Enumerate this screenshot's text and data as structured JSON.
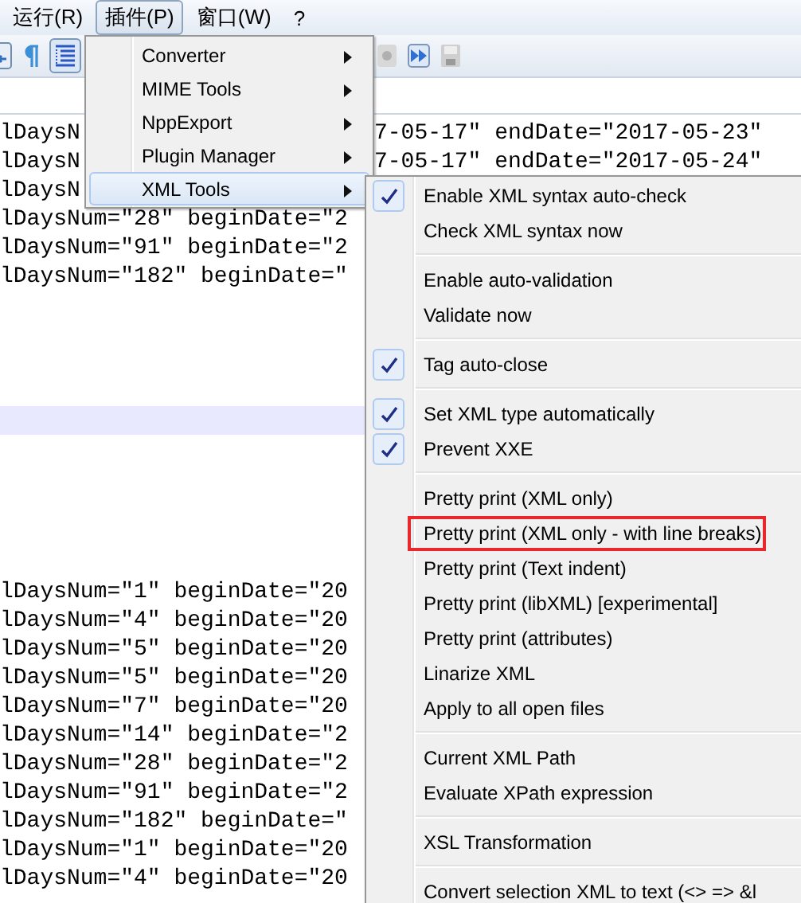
{
  "menubar": [
    {
      "label": "运行(R)",
      "selected": false
    },
    {
      "label": "插件(P)",
      "selected": true
    },
    {
      "label": "窗口(W)",
      "selected": false
    },
    {
      "label": "?",
      "selected": false
    }
  ],
  "toolbar": {
    "buttons": [
      {
        "selected": false
      },
      {
        "selected": false
      },
      {
        "selected": true
      },
      {
        "selected": false
      },
      {
        "selected": false
      },
      {
        "selected": false
      }
    ]
  },
  "editor": {
    "lines": [
      {
        "parts": [
          "lDaysN",
          "7-05-17\" endDate=\"2017-05-23\""
        ],
        "current": false
      },
      {
        "parts": [
          "lDaysN",
          "7-05-17\" endDate=\"2017-05-24\""
        ],
        "current": false
      },
      {
        "parts": [
          "lDaysN"
        ],
        "current": false
      },
      {
        "parts": [
          "lDaysNum=\"28\" beginDate=\"2"
        ],
        "current": false
      },
      {
        "parts": [
          "lDaysNum=\"91\" beginDate=\"2"
        ],
        "current": false
      },
      {
        "parts": [
          "lDaysNum=\"182\" beginDate=\""
        ],
        "current": false
      },
      {
        "current": false
      },
      {
        "current": false
      },
      {
        "current": false
      },
      {
        "current": false
      },
      {
        "current": true
      },
      {
        "current": false
      },
      {
        "current": false
      },
      {
        "current": false
      },
      {
        "current": false
      },
      {
        "current": false
      },
      {
        "parts": [
          "lDaysNum=\"1\" beginDate=\"20"
        ],
        "current": false
      },
      {
        "parts": [
          "lDaysNum=\"4\" beginDate=\"20"
        ],
        "current": false
      },
      {
        "parts": [
          "lDaysNum=\"5\" beginDate=\"20"
        ],
        "current": false
      },
      {
        "parts": [
          "lDaysNum=\"5\" beginDate=\"20"
        ],
        "current": false
      },
      {
        "parts": [
          "lDaysNum=\"7\" beginDate=\"20"
        ],
        "current": false
      },
      {
        "parts": [
          "lDaysNum=\"14\" beginDate=\"2"
        ],
        "current": false
      },
      {
        "parts": [
          "lDaysNum=\"28\" beginDate=\"2"
        ],
        "current": false
      },
      {
        "parts": [
          "lDaysNum=\"91\" beginDate=\"2"
        ],
        "current": false
      },
      {
        "parts": [
          "lDaysNum=\"182\" beginDate=\""
        ],
        "current": false
      },
      {
        "parts": [
          "lDaysNum=\"1\" beginDate=\"20"
        ],
        "current": false
      },
      {
        "parts": [
          "lDaysNum=\"4\" beginDate=\"20"
        ],
        "current": false
      }
    ]
  },
  "plugins_menu": {
    "items": [
      {
        "label": "Converter",
        "selected": false
      },
      {
        "label": "MIME Tools",
        "selected": false
      },
      {
        "label": "NppExport",
        "selected": false
      },
      {
        "label": "Plugin Manager",
        "selected": false
      },
      {
        "label": "XML Tools",
        "selected": true
      }
    ]
  },
  "xml_tools_menu": {
    "items": [
      {
        "kind": "item",
        "label": "Enable XML syntax auto-check",
        "checked": true,
        "boxed": false
      },
      {
        "kind": "item",
        "label": "Check XML syntax now",
        "checked": false,
        "boxed": false
      },
      {
        "kind": "separator"
      },
      {
        "kind": "item",
        "label": "Enable auto-validation",
        "checked": false,
        "boxed": false
      },
      {
        "kind": "item",
        "label": "Validate now",
        "checked": false,
        "boxed": false
      },
      {
        "kind": "separator"
      },
      {
        "kind": "item",
        "label": "Tag auto-close",
        "checked": true,
        "boxed": false
      },
      {
        "kind": "separator"
      },
      {
        "kind": "item",
        "label": "Set XML type automatically",
        "checked": true,
        "boxed": false
      },
      {
        "kind": "item",
        "label": "Prevent XXE",
        "checked": true,
        "boxed": false
      },
      {
        "kind": "separator"
      },
      {
        "kind": "item",
        "label": "Pretty print (XML only)",
        "checked": false,
        "boxed": false
      },
      {
        "kind": "item",
        "label": "Pretty print (XML only - with line breaks)",
        "checked": false,
        "boxed": true
      },
      {
        "kind": "item",
        "label": "Pretty print (Text indent)",
        "checked": false,
        "boxed": false
      },
      {
        "kind": "item",
        "label": "Pretty print (libXML) [experimental]",
        "checked": false,
        "boxed": false
      },
      {
        "kind": "item",
        "label": "Pretty print (attributes)",
        "checked": false,
        "boxed": false
      },
      {
        "kind": "item",
        "label": "Linarize XML",
        "checked": false,
        "boxed": false
      },
      {
        "kind": "item",
        "label": "Apply to all open files",
        "checked": false,
        "boxed": false
      },
      {
        "kind": "separator"
      },
      {
        "kind": "item",
        "label": "Current XML Path",
        "checked": false,
        "boxed": false
      },
      {
        "kind": "item",
        "label": "Evaluate XPath expression",
        "checked": false,
        "boxed": false
      },
      {
        "kind": "separator"
      },
      {
        "kind": "item",
        "label": "XSL Transformation",
        "checked": false,
        "boxed": false
      },
      {
        "kind": "separator"
      },
      {
        "kind": "item",
        "label": "Convert selection XML to text (<> => &l",
        "checked": false,
        "boxed": false
      }
    ]
  }
}
